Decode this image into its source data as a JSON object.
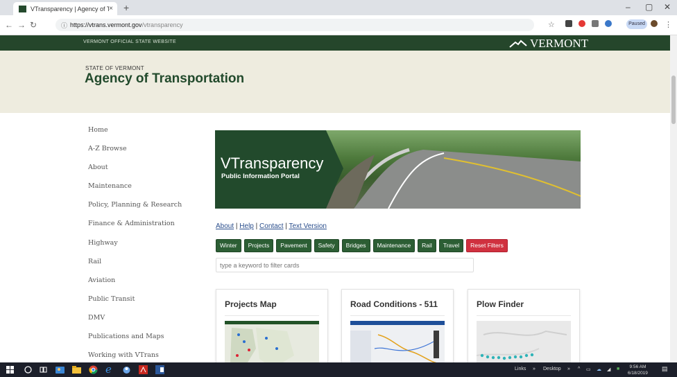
{
  "browser": {
    "tab_title": "VTransparency | Agency of Trans",
    "tab_close": "×",
    "new_tab": "+",
    "url_host": "https://vtrans.vermont.gov",
    "url_path": "/vtransparency",
    "profile_label": "Paused",
    "window_controls": [
      "–",
      "▢",
      "✕"
    ]
  },
  "site": {
    "official_label": "VERMONT OFFICIAL STATE WEBSITE",
    "vermont_logo_text": "VERMONT",
    "state_label": "STATE OF VERMONT",
    "agency_title": "Agency of Transportation"
  },
  "sidebar": {
    "items": [
      "Home",
      "A-Z Browse",
      "About",
      "Maintenance",
      "Policy, Planning & Research",
      "Finance & Administration",
      "Highway",
      "Rail",
      "Aviation",
      "Public Transit",
      "DMV",
      "Publications and Maps",
      "Working with VTrans"
    ]
  },
  "hero": {
    "title": "VTransparency",
    "subtitle": "Public Information Portal"
  },
  "links": {
    "about": "About",
    "help": "Help",
    "contact": "Contact",
    "text_version": "Text Version",
    "separator": " | "
  },
  "filters": {
    "buttons": [
      "Winter",
      "Projects",
      "Pavement",
      "Safety",
      "Bridges",
      "Maintenance",
      "Rail",
      "Travel"
    ],
    "reset": "Reset Filters"
  },
  "search": {
    "placeholder": "type a keyword to filter cards"
  },
  "cards": [
    {
      "title": "Projects Map"
    },
    {
      "title": "Road Conditions - 511"
    },
    {
      "title": "Plow Finder"
    }
  ],
  "taskbar": {
    "links_label": "Links",
    "desktop_label": "Desktop",
    "time": "9:56 AM",
    "date": "6/18/2019"
  },
  "colors": {
    "vt_green": "#25462b",
    "header_beige": "#eeecdf",
    "filter_green": "#2c5e34",
    "reset_red": "#d0313f",
    "link_blue": "#2a4e8c"
  }
}
